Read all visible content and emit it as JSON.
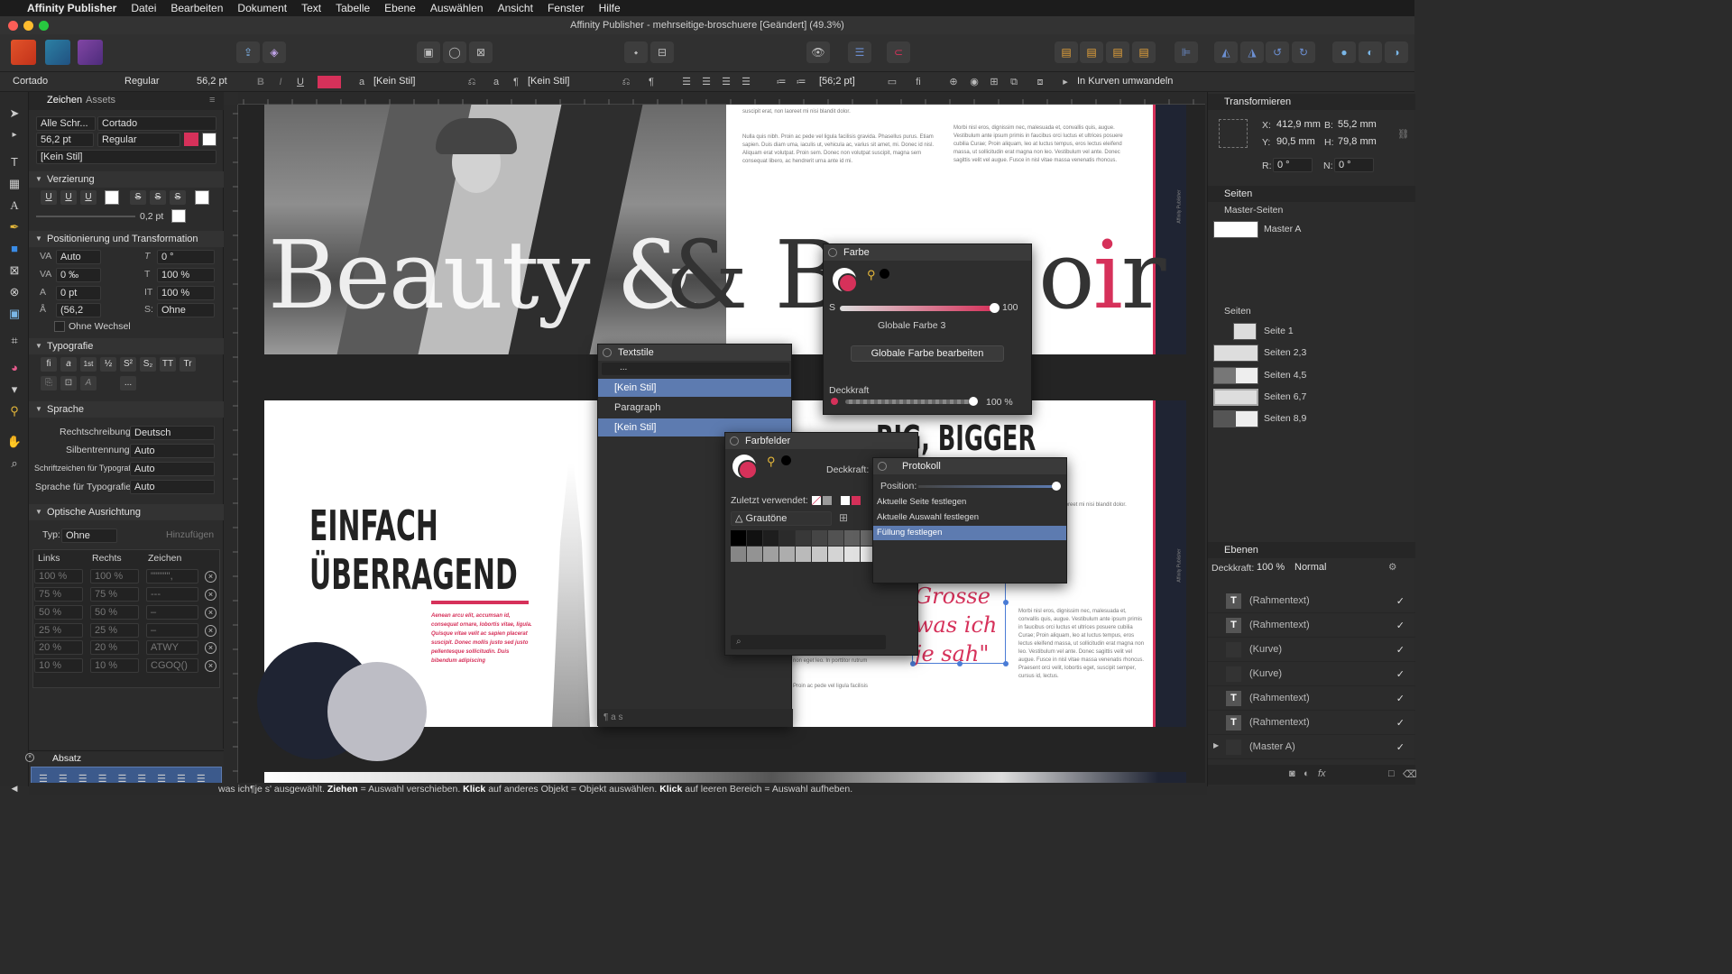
{
  "menubar": {
    "app_name": "Affinity Publisher",
    "items": [
      "Datei",
      "Bearbeiten",
      "Dokument",
      "Text",
      "Tabelle",
      "Ebene",
      "Auswählen",
      "Ansicht",
      "Fenster",
      "Hilfe"
    ]
  },
  "window": {
    "title": "Affinity Publisher - mehrseitige-broschuere [Geändert] (49.3%)"
  },
  "context_toolbar": {
    "font_family": "Cortado",
    "font_style": "Regular",
    "font_size": "56,2 pt",
    "char_style": "[Kein Stil]",
    "para_style": "[Kein Stil]",
    "baseline": "[56;2 pt]",
    "convert_curves": "In Kurven umwandeln",
    "bold": "B",
    "italic": "I",
    "underline": "U",
    "text_color": "#d6315a"
  },
  "left_panel": {
    "tabs": [
      "Zeichen",
      "Assets"
    ],
    "font_group": "Alle Schr...",
    "font_family": "Cortado",
    "font_size": "56,2 pt",
    "font_style": "Regular",
    "style": "[Kein Stil]",
    "verzierung": {
      "title": "Verzierung",
      "buttons": [
        "U",
        "U",
        "U",
        "S",
        "S",
        "S"
      ],
      "stroke": "0,2 pt"
    },
    "positionierung": {
      "title": "Positionierung und Transformation",
      "kerning": "Auto",
      "skew": "0 °",
      "tracking": "0 ‰",
      "scale_h": "100 %",
      "baseline": "0 pt",
      "scale_v": "100 %",
      "leading": "(56,2",
      "shear": "Ohne",
      "no_break": "Ohne Wechsel"
    },
    "typografie": {
      "title": "Typografie",
      "buttons": [
        "fi",
        "a",
        "1st",
        "½",
        "S²",
        "S₂",
        "TT",
        "Tr"
      ],
      "more": "..."
    },
    "sprache": {
      "title": "Sprache",
      "rows": [
        {
          "label": "Rechtschreibung:",
          "value": "Deutsch"
        },
        {
          "label": "Silbentrennung:",
          "value": "Auto"
        },
        {
          "label": "Schriftzeichen für Typografie:",
          "value": "Auto"
        },
        {
          "label": "Sprache für Typografie:",
          "value": "Auto"
        }
      ]
    },
    "optische": {
      "title": "Optische Ausrichtung",
      "typ_label": "Typ:",
      "typ_value": "Ohne",
      "add": "Hinzufügen",
      "headers": [
        "Links",
        "Rechts",
        "Zeichen"
      ],
      "rows": [
        [
          "100 %",
          "100 %",
          "\"\"\"\"\"',"
        ],
        [
          "75 %",
          "75 %",
          "---"
        ],
        [
          "50 %",
          "50 %",
          "–"
        ],
        [
          "25 %",
          "25 %",
          "–"
        ],
        [
          "20 %",
          "20 %",
          "ATWY"
        ],
        [
          "10 %",
          "10 %",
          "CGOQ()"
        ]
      ]
    },
    "absatz": "Absatz"
  },
  "canvas": {
    "hero_text": "Beauty & Boudoir",
    "headline_1": "EINFACH",
    "headline_2": "ÜBERRAGEND",
    "big_bigger": "BIG, BIGGER",
    "script_1": "Grosse",
    "script_2": "was ich",
    "script_3": "je sah\"",
    "body_top_1": "suscipit erat, non laoreet mi nisi blandit dolor.",
    "body_top_2": "Nulla quis nibh. Proin ac pede vel ligula facilisis gravida. Phasellus purus. Etiam sapien. Duis diam uma, iaculis ut, vehicula ac, varius sit amet, mi. Donec id nisl. Aliquam erat volutpat. Proin sem. Donec non volutpat suscipit, magna sem consequat libero, ac hendrerit urna ante id mi.",
    "body_top_3": "Morbi nisl eros, dignissim nec, malesuada et, convallis quis, augue. Vestibulum ante ipsum primis in faucibus orci luctus et ultrices posuere cubilia Curae; Proin aliquam, leo at luctus tempus, eros lectus eleifend massa, ut sollicitudin erat magna non leo. Vestibulum vel ante. Donec sagittis velit vel augue. Fusce in nisl vitae massa venenatis rhoncus.",
    "body_right_1": "suscipit erat, non laoreet mi nisi blandit dolor.",
    "body_right_2": "Morbi nisl eros, dignissim nec, malesuada et, convallis quis, augue. Vestibulum ante ipsum primis in faucibus orci luctus et ultrices posuere cubilia Curae; Proin aliquam, leo at luctus tempus, eros lectus eleifend massa, ut sollicitudin erat magna non leo. Vestibulum vel ante. Donec sagittis velit vel augue. Fusce in nisl vitae massa venenatis rhoncus. Praesent orci velit, lobortis eget, suscipit semper, cursus id, lectus.",
    "pink_body": "Aenean arcu elit, accumsan id, consequat ornare, lobortis vitae, ligula. Quisque vitae velit ac sapien placerat suscipit. Donec mollis justo sed justo pellentesque sollicitudin. Duis bibendum adipiscing",
    "sidebar_label": "Affinity Publisher",
    "bottom_text_1": "non eget leo. In porttitor rutrum",
    "bottom_text_2": "Proin ac pede vel ligula facilisis"
  },
  "textstile_panel": {
    "title": "Textstile",
    "search": "...",
    "rows": [
      "[Kein Stil]",
      "Paragraph",
      "[Kein Stil]"
    ]
  },
  "farbe_panel": {
    "title": "Farbe",
    "s_label": "S",
    "s_value": "100",
    "global_name": "Globale Farbe 3",
    "edit_button": "Globale Farbe bearbeiten",
    "opacity_label": "Deckkraft",
    "opacity_value": "100 %",
    "color": "#d6315a"
  },
  "farbfelder_panel": {
    "title": "Farbfelder",
    "opacity_label": "Deckkraft:",
    "recent_label": "Zuletzt verwendet:",
    "palette": "Grautöne",
    "grays": [
      "#000000",
      "#111111",
      "#1e1e1e",
      "#2b2b2b",
      "#383838",
      "#454545",
      "#525252",
      "#5f5f5f",
      "#6c6c6c",
      "#797979",
      "#868686",
      "#939393",
      "#a0a0a0",
      "#adadad",
      "#bababa",
      "#c7c7c7",
      "#d4d4d4",
      "#e1e1e1",
      "#eeeeee",
      "#ffffff"
    ]
  },
  "protokoll_panel": {
    "title": "Protokoll",
    "position_label": "Position:",
    "items": [
      "Aktuelle Seite festlegen",
      "Aktuelle Auswahl festlegen",
      "Füllung festlegen"
    ]
  },
  "transform_panel": {
    "title": "Transformieren",
    "x_label": "X:",
    "x": "412,9 mm",
    "b_label": "B:",
    "b": "55,2 mm",
    "y_label": "Y:",
    "y": "90,5 mm",
    "h_label": "H:",
    "h": "79,8 mm",
    "r_label": "R:",
    "r": "0 °",
    "n_label": "N:",
    "n": "0 °"
  },
  "seiten_panel": {
    "title": "Seiten",
    "master_header": "Master-Seiten",
    "masters": [
      "Master A"
    ],
    "pages_header": "Seiten",
    "pages": [
      "Seite 1",
      "Seiten 2,3",
      "Seiten 4,5",
      "Seiten 6,7",
      "Seiten 8,9"
    ]
  },
  "ebenen_panel": {
    "title": "Ebenen",
    "opacity_label": "Deckkraft:",
    "opacity": "100 %",
    "blend": "Normal",
    "layers": [
      "(Rahmentext)",
      "(Rahmentext)",
      "(Kurve)",
      "(Kurve)",
      "(Rahmentext)",
      "(Rahmentext)",
      "(Master A)"
    ]
  },
  "statusbar": {
    "prefix": "was ich¶je s' ausgewählt.",
    "drag": "Ziehen",
    "drag_text": "= Auswahl verschieben.",
    "click": "Klick",
    "click_text": "auf anderes Objekt = Objekt auswählen.",
    "click2": "Klick",
    "click2_text": "auf leeren Bereich = Auswahl aufheben."
  },
  "colors": {
    "accent_pink": "#d6315a",
    "selection_blue": "#5d7bb0",
    "dark_navy": "#1f2433"
  }
}
